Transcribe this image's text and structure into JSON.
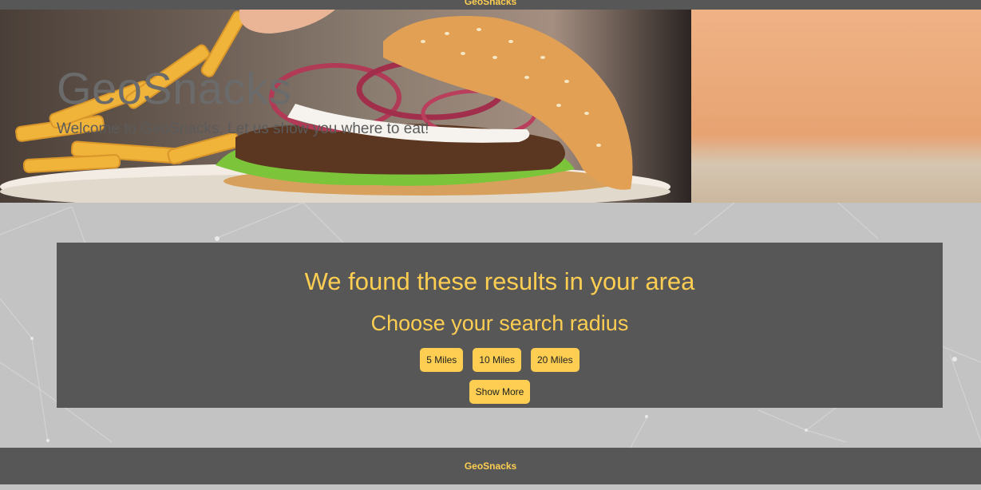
{
  "topbar": {
    "brand": "GeoSnacks"
  },
  "hero": {
    "title": "GeoSnacks",
    "subtitle": "Welcome to GeoSnacks. Let us show you where to eat!",
    "image": "burger-and-fries-photo"
  },
  "results": {
    "heading": "We found these results in your area",
    "radius_heading": "Choose your search radius",
    "radius_options": [
      "5 Miles",
      "10 Miles",
      "20 Miles"
    ],
    "show_more_label": "Show More"
  },
  "footer": {
    "brand": "GeoSnacks"
  },
  "colors": {
    "accent": "#fdce52",
    "bar": "#575757",
    "page_bg": "#c3c3c3",
    "hero_title": "#6b6b6b"
  }
}
